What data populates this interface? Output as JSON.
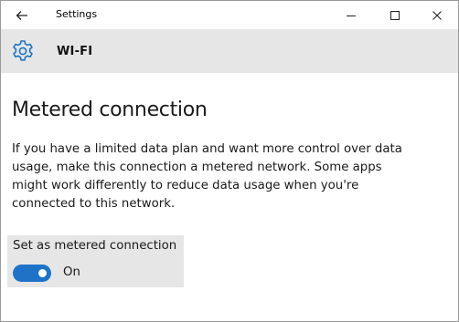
{
  "window": {
    "title": "Settings"
  },
  "header": {
    "title": "WI-FI",
    "icon": "gear-icon"
  },
  "content": {
    "page_title": "Metered connection",
    "description": "If you have a limited data plan and want more control over data usage, make this connection a metered network. Some apps might work differently to reduce data usage when you're connected to this network.",
    "toggle": {
      "label": "Set as metered connection",
      "state_text": "On",
      "checked": true
    }
  },
  "colors": {
    "accent": "#1e73c9",
    "header_band": "#e6e6e6"
  }
}
